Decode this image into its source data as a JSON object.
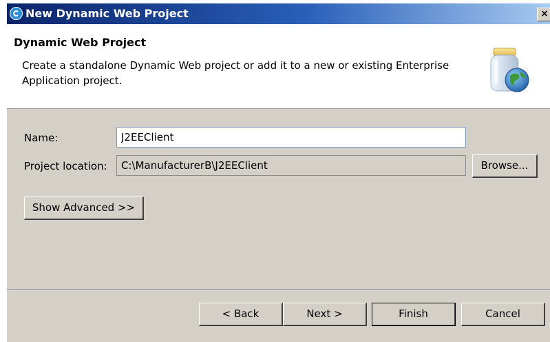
{
  "window": {
    "title": "New Dynamic Web Project",
    "close_symbol": "×",
    "icons": {
      "app": "eclipse-app-icon",
      "close": "close-icon",
      "banner": "jar-globe-icon"
    }
  },
  "header": {
    "title": "Dynamic Web Project",
    "description": "Create a standalone Dynamic Web project or add it to a new or existing Enterprise Application project."
  },
  "form": {
    "name_label": "Name:",
    "name_value": "J2EEClient",
    "location_label": "Project location:",
    "location_value": "C:\\ManufacturerB\\J2EEClient",
    "browse_label": "Browse...",
    "advanced_label": "Show Advanced >>"
  },
  "buttons": {
    "back": "< Back",
    "next": "Next >",
    "finish": "Finish",
    "cancel": "Cancel"
  },
  "colors": {
    "title_bar_start": "#0a246a",
    "title_bar_end": "#a6caf0",
    "dialog_face": "#d4d0c8"
  }
}
